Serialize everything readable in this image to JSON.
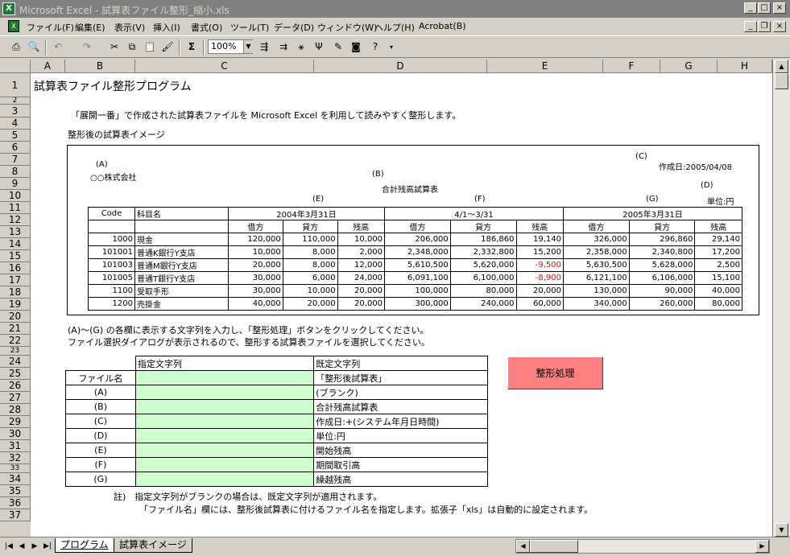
{
  "window": {
    "title": "Microsoft Excel - 試算表ファイル整形_縮小.xls"
  },
  "menu": [
    "ファイル(F)",
    "編集(E)",
    "表示(V)",
    "挿入(I)",
    "書式(O)",
    "ツール(T)",
    "データ(D)",
    "ウィンドウ(W)",
    "ヘルプ(H)",
    "Acrobat(B)"
  ],
  "toolbar": {
    "zoom": "100%",
    "sigma": "Σ"
  },
  "columns": [
    "A",
    "B",
    "C",
    "D",
    "E",
    "F",
    "G",
    "H"
  ],
  "rows": [
    "1",
    "2",
    "3",
    "4",
    "5",
    "6",
    "7",
    "8",
    "9",
    "10",
    "11",
    "12",
    "13",
    "14",
    "15",
    "16",
    "17",
    "18",
    "19",
    "20",
    "21",
    "22",
    "23",
    "24",
    "25",
    "26",
    "27",
    "28",
    "29",
    "30",
    "31",
    "32",
    "33",
    "34",
    "35",
    "36",
    "37"
  ],
  "sheet": {
    "title": "試算表ファイル整形プログラム",
    "desc": "「展開一番」で作成された試算表ファイルを Microsoft Excel を利用して読みやすく整形します。",
    "image_label": "整形後の試算表イメージ",
    "preview": {
      "mark_a": "(A)",
      "company": "○○株式会社",
      "mark_b": "(B)",
      "report_title": "合計残高試算表",
      "mark_c": "(C)",
      "created": "作成日:2005/04/08",
      "mark_d": "(D)",
      "unit": "単位:円",
      "mark_e": "(E)",
      "mark_f": "(F)",
      "mark_g": "(G)",
      "h_code": "Code",
      "h_name": "科目名",
      "period1": "2004年3月31日",
      "period2": "4/1～3/31",
      "period3": "2005年3月31日",
      "debit": "借方",
      "credit": "貸方",
      "balance": "残高",
      "rows": [
        {
          "code": "1000",
          "name": "現金",
          "v": [
            "120,000",
            "110,000",
            "10,000",
            "206,000",
            "186,860",
            "19,140",
            "326,000",
            "296,860",
            "29,140"
          ],
          "neg": [
            false,
            false,
            false,
            false,
            false,
            false,
            false,
            false,
            false
          ]
        },
        {
          "code": "101001",
          "name": "普通K銀行Y支店",
          "v": [
            "10,000",
            "8,000",
            "2,000",
            "2,348,000",
            "2,332,800",
            "15,200",
            "2,358,000",
            "2,340,800",
            "17,200"
          ],
          "neg": [
            false,
            false,
            false,
            false,
            false,
            false,
            false,
            false,
            false
          ]
        },
        {
          "code": "101003",
          "name": "普通M銀行Y支店",
          "v": [
            "20,000",
            "8,000",
            "12,000",
            "5,610,500",
            "5,620,000",
            "-9,500",
            "5,630,500",
            "5,628,000",
            "2,500"
          ],
          "neg": [
            false,
            false,
            false,
            false,
            false,
            true,
            false,
            false,
            false
          ]
        },
        {
          "code": "101005",
          "name": "普通T銀行Y支店",
          "v": [
            "30,000",
            "6,000",
            "24,000",
            "6,091,100",
            "6,100,000",
            "-8,900",
            "6,121,100",
            "6,106,000",
            "15,100"
          ],
          "neg": [
            false,
            false,
            false,
            false,
            false,
            true,
            false,
            false,
            false
          ]
        },
        {
          "code": "1100",
          "name": "受取手形",
          "v": [
            "30,000",
            "10,000",
            "20,000",
            "100,000",
            "80,000",
            "20,000",
            "130,000",
            "90,000",
            "40,000"
          ],
          "neg": [
            false,
            false,
            false,
            false,
            false,
            false,
            false,
            false,
            false
          ]
        },
        {
          "code": "1200",
          "name": "売掛金",
          "v": [
            "40,000",
            "20,000",
            "20,000",
            "300,000",
            "240,000",
            "60,000",
            "340,000",
            "260,000",
            "80,000"
          ],
          "neg": [
            false,
            false,
            false,
            false,
            false,
            false,
            false,
            false,
            false
          ]
        }
      ]
    },
    "instr1": "(A)～(G) の各欄に表示する文字列を入力し、「整形処理」ボタンをクリックしてください。",
    "instr2": "ファイル選択ダイアログが表示されるので、整形する試算表ファイルを選択してください。",
    "settings": {
      "h_spec": "指定文字列",
      "h_default": "既定文字列",
      "rows": [
        {
          "label": "ファイル名",
          "default": "「整形後試算表」"
        },
        {
          "label": "(A)",
          "default": "(ブランク)"
        },
        {
          "label": "(B)",
          "default": "合計残高試算表"
        },
        {
          "label": "(C)",
          "default": "作成日:+(システム年月日時間)"
        },
        {
          "label": "(D)",
          "default": "単位:円"
        },
        {
          "label": "(E)",
          "default": "開始残高"
        },
        {
          "label": "(F)",
          "default": "期間取引高"
        },
        {
          "label": "(G)",
          "default": "繰越残高"
        }
      ]
    },
    "button": "整形処理",
    "note1": "註)　指定文字列がブランクの場合は、既定文字列が適用されます。",
    "note2": "「ファイル名」欄には、整形後試算表に付けるファイル名を指定します。拡張子「xls」は自動的に設定されます。"
  },
  "tabs": [
    "プログラム",
    "試算表イメージ"
  ]
}
